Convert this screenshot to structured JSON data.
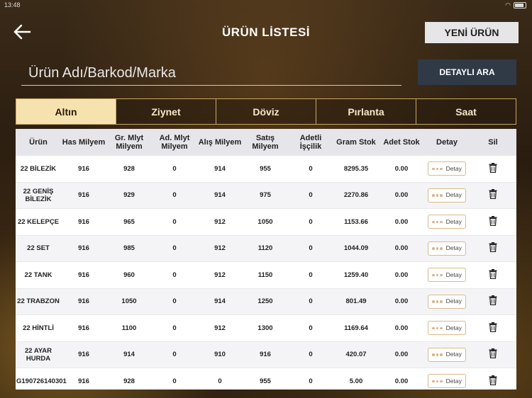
{
  "status": {
    "time": "13:48"
  },
  "header": {
    "title": "ÜRÜN LİSTESİ",
    "new_button": "YENİ ÜRÜN"
  },
  "search": {
    "placeholder": "Ürün Adı/Barkod/Marka",
    "advanced_button": "DETAYLI ARA"
  },
  "tabs": [
    {
      "label": "Altın",
      "active": true
    },
    {
      "label": "Ziynet",
      "active": false
    },
    {
      "label": "Döviz",
      "active": false
    },
    {
      "label": "Pırlanta",
      "active": false
    },
    {
      "label": "Saat",
      "active": false
    }
  ],
  "table": {
    "columns": [
      "Ürün",
      "Has Milyem",
      "Gr. Mlyt Milyem",
      "Ad. Mlyt Milyem",
      "Alış Milyem",
      "Satış Milyem",
      "Adetli İşçilik",
      "Gram Stok",
      "Adet Stok",
      "Detay",
      "Sil"
    ],
    "detail_label": "Detay",
    "rows": [
      {
        "urun": "22 BİLEZİK",
        "has": "916",
        "gr": "928",
        "ad": "0",
        "alis": "914",
        "satis": "955",
        "iscilik": "0",
        "gram": "8295.35",
        "adet": "0.00"
      },
      {
        "urun": "22 GENİŞ BİLEZİK",
        "has": "916",
        "gr": "929",
        "ad": "0",
        "alis": "914",
        "satis": "975",
        "iscilik": "0",
        "gram": "2270.86",
        "adet": "0.00"
      },
      {
        "urun": "22 KELEPÇE",
        "has": "916",
        "gr": "965",
        "ad": "0",
        "alis": "912",
        "satis": "1050",
        "iscilik": "0",
        "gram": "1153.66",
        "adet": "0.00"
      },
      {
        "urun": "22 SET",
        "has": "916",
        "gr": "985",
        "ad": "0",
        "alis": "912",
        "satis": "1120",
        "iscilik": "0",
        "gram": "1044.09",
        "adet": "0.00"
      },
      {
        "urun": "22 TANK",
        "has": "916",
        "gr": "960",
        "ad": "0",
        "alis": "912",
        "satis": "1150",
        "iscilik": "0",
        "gram": "1259.40",
        "adet": "0.00"
      },
      {
        "urun": "22 TRABZON",
        "has": "916",
        "gr": "1050",
        "ad": "0",
        "alis": "914",
        "satis": "1250",
        "iscilik": "0",
        "gram": "801.49",
        "adet": "0.00"
      },
      {
        "urun": "22 HİNTLİ",
        "has": "916",
        "gr": "1100",
        "ad": "0",
        "alis": "912",
        "satis": "1300",
        "iscilik": "0",
        "gram": "1169.64",
        "adet": "0.00"
      },
      {
        "urun": "22 AYAR HURDA",
        "has": "916",
        "gr": "914",
        "ad": "0",
        "alis": "910",
        "satis": "916",
        "iscilik": "0",
        "gram": "420.07",
        "adet": "0.00"
      },
      {
        "urun": "G190726140301",
        "has": "916",
        "gr": "928",
        "ad": "0",
        "alis": "0",
        "satis": "955",
        "iscilik": "0",
        "gram": "5.00",
        "adet": "0.00"
      }
    ]
  },
  "colors": {
    "accent": "#f6e2ae",
    "tab_border": "#c9a662",
    "search_button": "#2f3a46"
  }
}
